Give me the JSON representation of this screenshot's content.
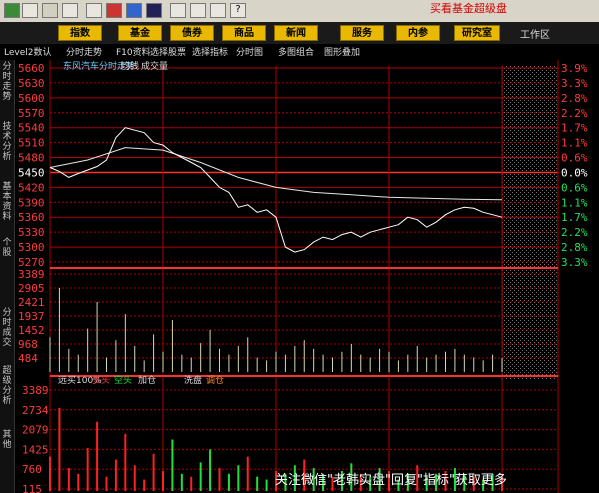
{
  "window": {
    "top_ad_text": "买看基金超级盘"
  },
  "menu": {
    "items": [
      "指数",
      "基金",
      "债券",
      "商品",
      "新闻",
      "服务",
      "内参",
      "研究室"
    ],
    "workspace_label": "工作区"
  },
  "toolbar": {
    "items": [
      "Level2数认",
      "分时走势",
      "F10资料",
      "选择股票",
      "选择指标",
      "分时图",
      "多图组合",
      "图形叠加"
    ]
  },
  "side_tabs": [
    "分时走势",
    "技术分析",
    "基本资料",
    "个股",
    "分时成交",
    "超级分析",
    "其他"
  ],
  "chart_header": {
    "title": "东风汽车分时走势",
    "legend_avg": "均线",
    "legend_vol": "成交量"
  },
  "price_axis": {
    "labels": [
      "5660",
      "5630",
      "5600",
      "5570",
      "5540",
      "5510",
      "5480",
      "5450",
      "5420",
      "5390",
      "5360",
      "5330",
      "5300",
      "5270"
    ],
    "reference": "5450"
  },
  "pct_axis": {
    "labels": [
      "3.9%",
      "3.3%",
      "2.8%",
      "2.2%",
      "1.7%",
      "1.1%",
      "0.6%",
      "0.0%",
      "0.6%",
      "1.1%",
      "1.7%",
      "2.2%",
      "2.8%",
      "3.3%"
    ]
  },
  "volume_axis": {
    "labels": [
      "3389",
      "2905",
      "2421",
      "1937",
      "1452",
      "968",
      "484"
    ]
  },
  "indicator": {
    "header": "远买100%",
    "items": [
      "多头",
      "空头",
      "加仓",
      "洗盘",
      "调仓"
    ],
    "y_labels": [
      "3389",
      "2734",
      "2079",
      "1425",
      "760",
      "115"
    ]
  },
  "watermark": "关注微信\"老韩实盘\"回复\"指标\"获取更多",
  "colors": {
    "grid_red": "#b00000",
    "price_line": "#ffffff",
    "avg_line": "#e6e6e6",
    "volume_bar": "#d8d8b0",
    "indicator_red": "#ff2020",
    "indicator_green": "#20e040",
    "menu_gold": "#e8b900"
  },
  "chart_data": {
    "type": "line",
    "title": "东风汽车分时走势",
    "ylabel": "",
    "ylim": [
      5270,
      5660
    ],
    "reference_price": 5450,
    "series": [
      {
        "name": "",
        "x": [
          0,
          5,
          10,
          15,
          20,
          25,
          30,
          35,
          40,
          45,
          50,
          55,
          60,
          65,
          70,
          75,
          80,
          85,
          90,
          95,
          100,
          105,
          110,
          115,
          120,
          125,
          130,
          135,
          140,
          145,
          150,
          155,
          160,
          165,
          170,
          175,
          180,
          185,
          190,
          195,
          200,
          205,
          210,
          215,
          220,
          225,
          230,
          235,
          240
        ],
        "values": [
          5460,
          5452,
          5440,
          5448,
          5455,
          5462,
          5475,
          5520,
          5540,
          5535,
          5530,
          5510,
          5505,
          5490,
          5480,
          5470,
          5460,
          5440,
          5420,
          5410,
          5380,
          5385,
          5370,
          5375,
          5360,
          5300,
          5290,
          5295,
          5310,
          5320,
          5315,
          5325,
          5330,
          5320,
          5330,
          5335,
          5340,
          5345,
          5360,
          5355,
          5340,
          5350,
          5365,
          5375,
          5380,
          5378,
          5370,
          5365,
          5360
        ]
      },
      {
        "name": "均线",
        "x": [
          0,
          20,
          40,
          60,
          80,
          100,
          120,
          140,
          160,
          180,
          200,
          220,
          240
        ],
        "values": [
          5460,
          5475,
          5500,
          5495,
          5470,
          5440,
          5420,
          5410,
          5405,
          5400,
          5398,
          5396,
          5395
        ]
      }
    ],
    "volume": {
      "ylim": [
        0,
        3389
      ],
      "values": [
        1200,
        2905,
        800,
        600,
        1500,
        2421,
        500,
        1100,
        2000,
        900,
        400,
        1300,
        700,
        1800,
        600,
        500,
        1000,
        1452,
        800,
        600,
        900,
        1200,
        500,
        400,
        700,
        600,
        900,
        1100,
        800,
        600,
        500,
        700,
        968,
        600,
        500,
        800,
        700,
        400,
        600,
        900,
        500,
        600,
        700,
        800,
        600,
        500,
        400,
        600,
        484
      ]
    }
  }
}
